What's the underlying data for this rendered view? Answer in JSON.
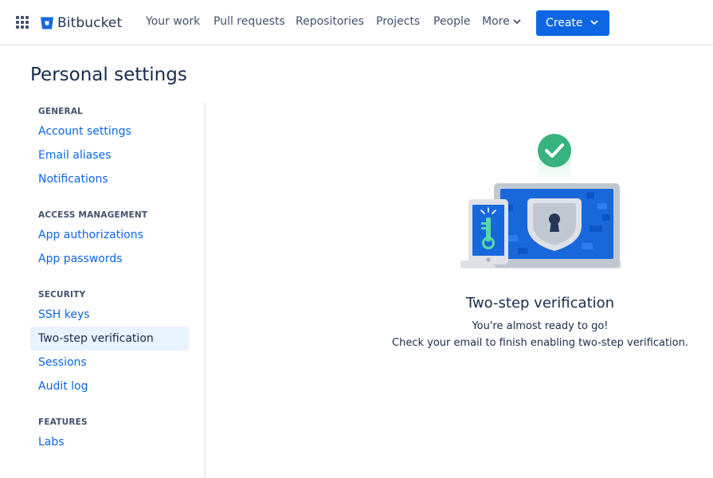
{
  "app": {
    "name": "Bitbucket",
    "brand_color": "#0c66e4"
  },
  "nav": {
    "items": [
      {
        "label": "Your work"
      },
      {
        "label": "Pull requests"
      },
      {
        "label": "Repositories"
      },
      {
        "label": "Projects"
      },
      {
        "label": "People"
      }
    ],
    "more_label": "More",
    "create_label": "Create"
  },
  "page": {
    "title": "Personal settings"
  },
  "sidebar": {
    "sections": [
      {
        "heading": "GENERAL",
        "items": [
          {
            "label": "Account settings"
          },
          {
            "label": "Email aliases"
          },
          {
            "label": "Notifications"
          }
        ]
      },
      {
        "heading": "ACCESS MANAGEMENT",
        "items": [
          {
            "label": "App authorizations"
          },
          {
            "label": "App passwords"
          }
        ]
      },
      {
        "heading": "SECURITY",
        "items": [
          {
            "label": "SSH keys"
          },
          {
            "label": "Two-step verification",
            "active": true
          },
          {
            "label": "Sessions"
          },
          {
            "label": "Audit log"
          }
        ]
      },
      {
        "heading": "FEATURES",
        "items": [
          {
            "label": "Labs"
          }
        ]
      }
    ]
  },
  "main": {
    "heading": "Two-step verification",
    "line1": "You're almost ready to go!",
    "line2": "Check your email to finish enabling two-step verification."
  },
  "icons": {
    "app_switcher": "grid-icon",
    "logo": "bitbucket-logo-icon",
    "more_chevron": "chevron-down-icon",
    "create_chevron": "chevron-down-icon",
    "illustration": "laptop-phone-lock-illustration",
    "success": "check-circle-icon"
  }
}
